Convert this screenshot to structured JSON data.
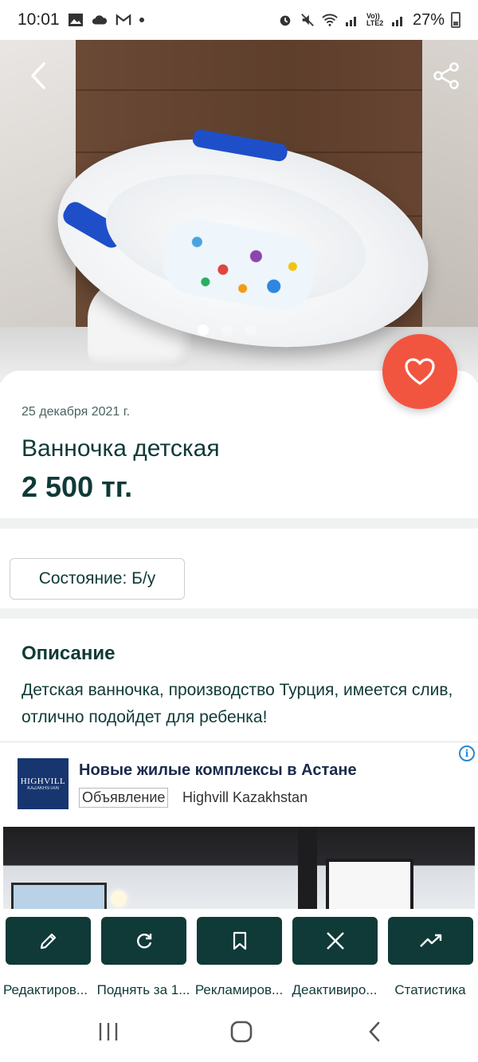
{
  "status_bar": {
    "time": "10:01",
    "network_label": "Vo)) LTE2",
    "battery": "27%"
  },
  "hero": {
    "photo_count": 3,
    "active_photo": 1
  },
  "listing": {
    "date": "25 декабря 2021 г.",
    "title": "Ванночка детская",
    "price": "2 500 тг.",
    "condition": "Состояние: Б/у",
    "description_title": "Описание",
    "description": "Детская ванночка, производство Турция, имеется слив, отлично подойдет для ребенка!"
  },
  "ad": {
    "logo_text": "HIGHVILL",
    "logo_subtext": "KAZAKHSTAN",
    "title": "Новые жилые комплексы в Астане",
    "badge": "Объявление",
    "advertiser": "Highvill Kazakhstan",
    "info_icon": "i"
  },
  "actions": [
    {
      "label": "Редактиров...",
      "icon": "pencil-icon"
    },
    {
      "label": "Поднять за 1...",
      "icon": "refresh-icon"
    },
    {
      "label": "Рекламиров...",
      "icon": "bookmark-icon"
    },
    {
      "label": "Деактивиро...",
      "icon": "close-icon"
    },
    {
      "label": "Статистика",
      "icon": "trending-up-icon"
    }
  ],
  "colors": {
    "primary": "#0f3a37",
    "favorite": "#f1553f",
    "separator": "#f0f2f2"
  }
}
